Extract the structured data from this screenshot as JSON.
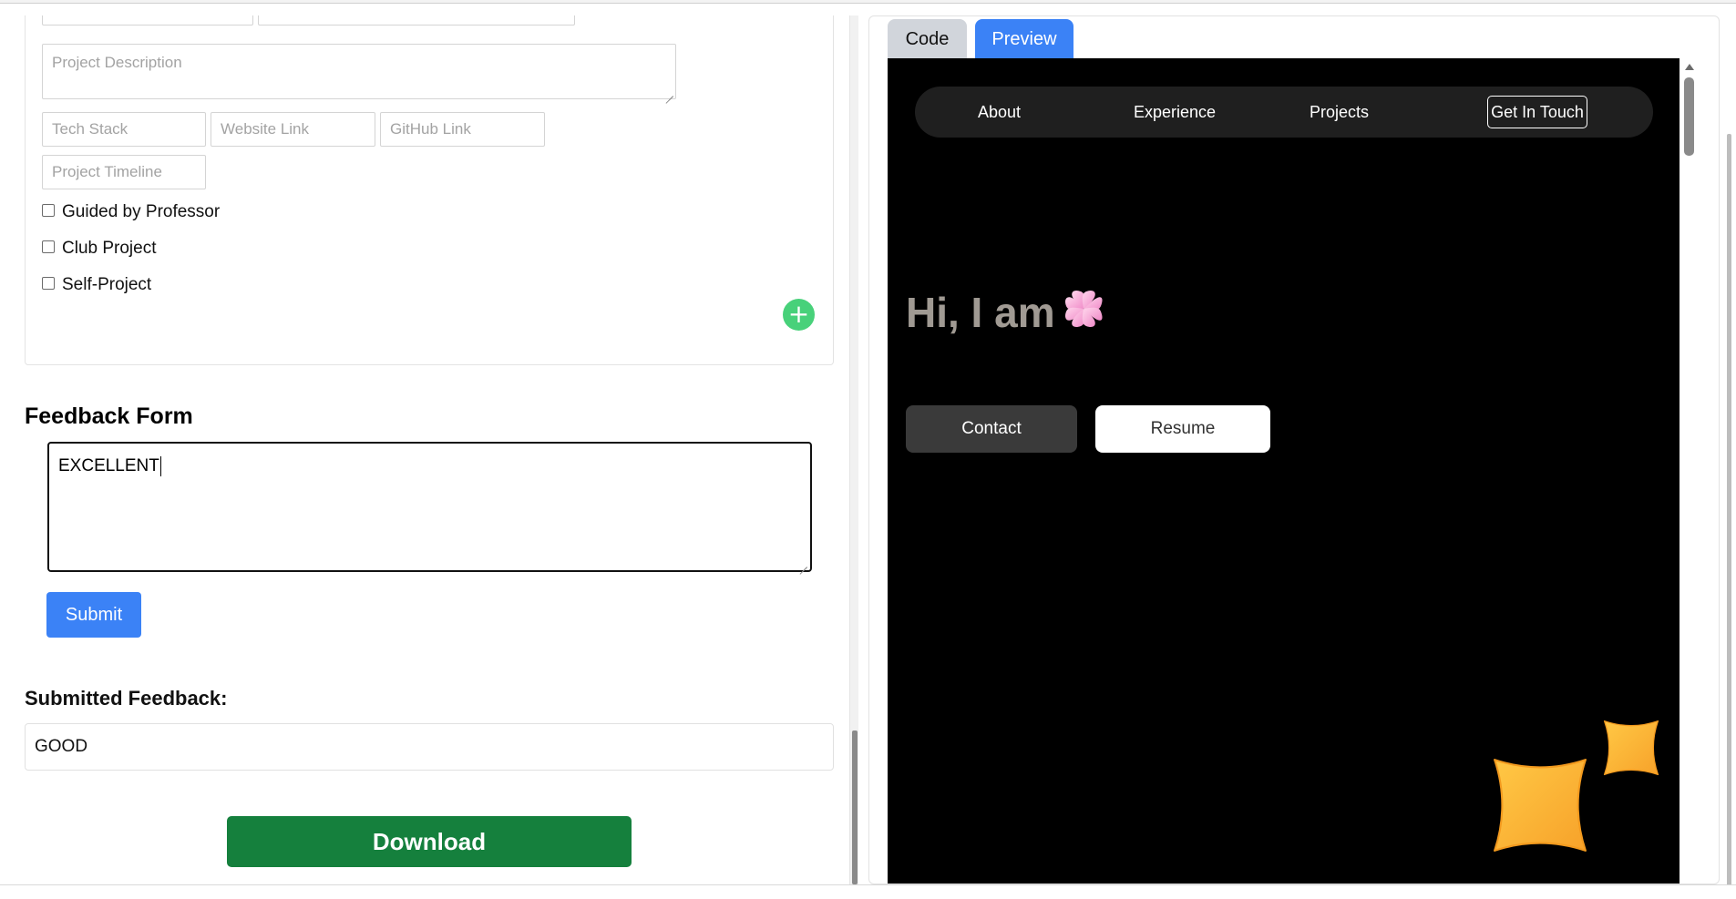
{
  "project_form": {
    "description_placeholder": "Project Description",
    "tech_stack_placeholder": "Tech Stack",
    "website_placeholder": "Website Link",
    "github_placeholder": "GitHub Link",
    "timeline_placeholder": "Project Timeline",
    "checkboxes": [
      {
        "label": "Guided by Professor",
        "checked": false
      },
      {
        "label": "Club Project",
        "checked": false
      },
      {
        "label": "Self-Project",
        "checked": false
      }
    ],
    "add_icon": "plus-circle-icon",
    "add_symbol": "+"
  },
  "feedback": {
    "title": "Feedback Form",
    "input_value": "EXCELLENT",
    "submit_label": "Submit",
    "submitted_label": "Submitted Feedback:",
    "submitted_value": "GOOD"
  },
  "download_label": "Download",
  "tabs": [
    {
      "label": "Code",
      "active": false
    },
    {
      "label": "Preview",
      "active": true
    }
  ],
  "preview": {
    "nav": [
      "About",
      "Experience",
      "Projects"
    ],
    "nav_cta": "Get In Touch",
    "hero_title": "Hi, I am",
    "contact_label": "Contact",
    "resume_label": "Resume",
    "icons": [
      "flower-icon",
      "sparkle-star-icon"
    ]
  },
  "colors": {
    "primary_blue": "#3b82f6",
    "download_green": "#15803d",
    "add_green": "#48d17a",
    "preview_bg": "#000000",
    "star_orange": "#fbb03b",
    "flower_pink": "#f6a6d6"
  }
}
